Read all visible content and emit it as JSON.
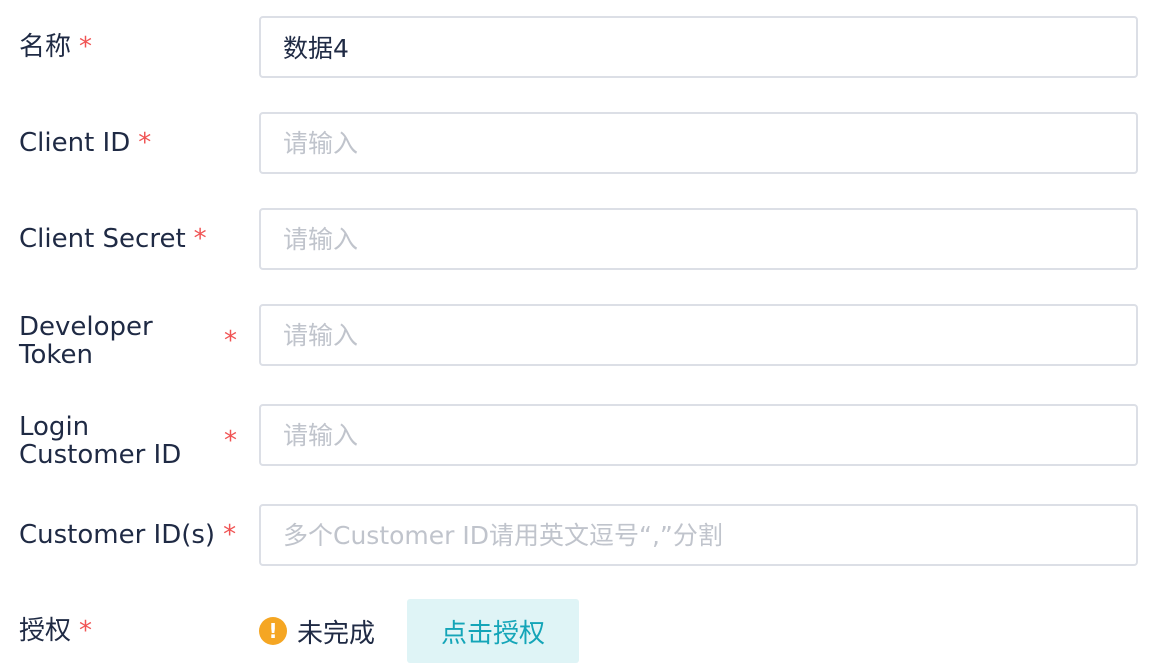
{
  "required_mark": "*",
  "form": {
    "name": {
      "label": "名称",
      "value": "数据4"
    },
    "client_id": {
      "label": "Client ID",
      "placeholder": "请输入"
    },
    "client_secret": {
      "label": "Client Secret",
      "placeholder": "请输入"
    },
    "developer_token": {
      "label": "Developer Token",
      "placeholder": "请输入"
    },
    "login_customer_id": {
      "label": "Login Customer ID",
      "placeholder": "请输入"
    },
    "customer_ids": {
      "label": "Customer ID(s)",
      "placeholder": "多个Customer ID请用英文逗号“,”分割"
    },
    "authorization": {
      "label": "授权",
      "status_icon": "!",
      "status": "未完成",
      "button_label": "点击授权"
    }
  },
  "colors": {
    "required": "#f05454",
    "warning": "#f5a623",
    "button_bg": "#dff4f6",
    "button_text": "#14a5b8",
    "border": "#dcdfe6",
    "placeholder": "#c0c4cc"
  }
}
